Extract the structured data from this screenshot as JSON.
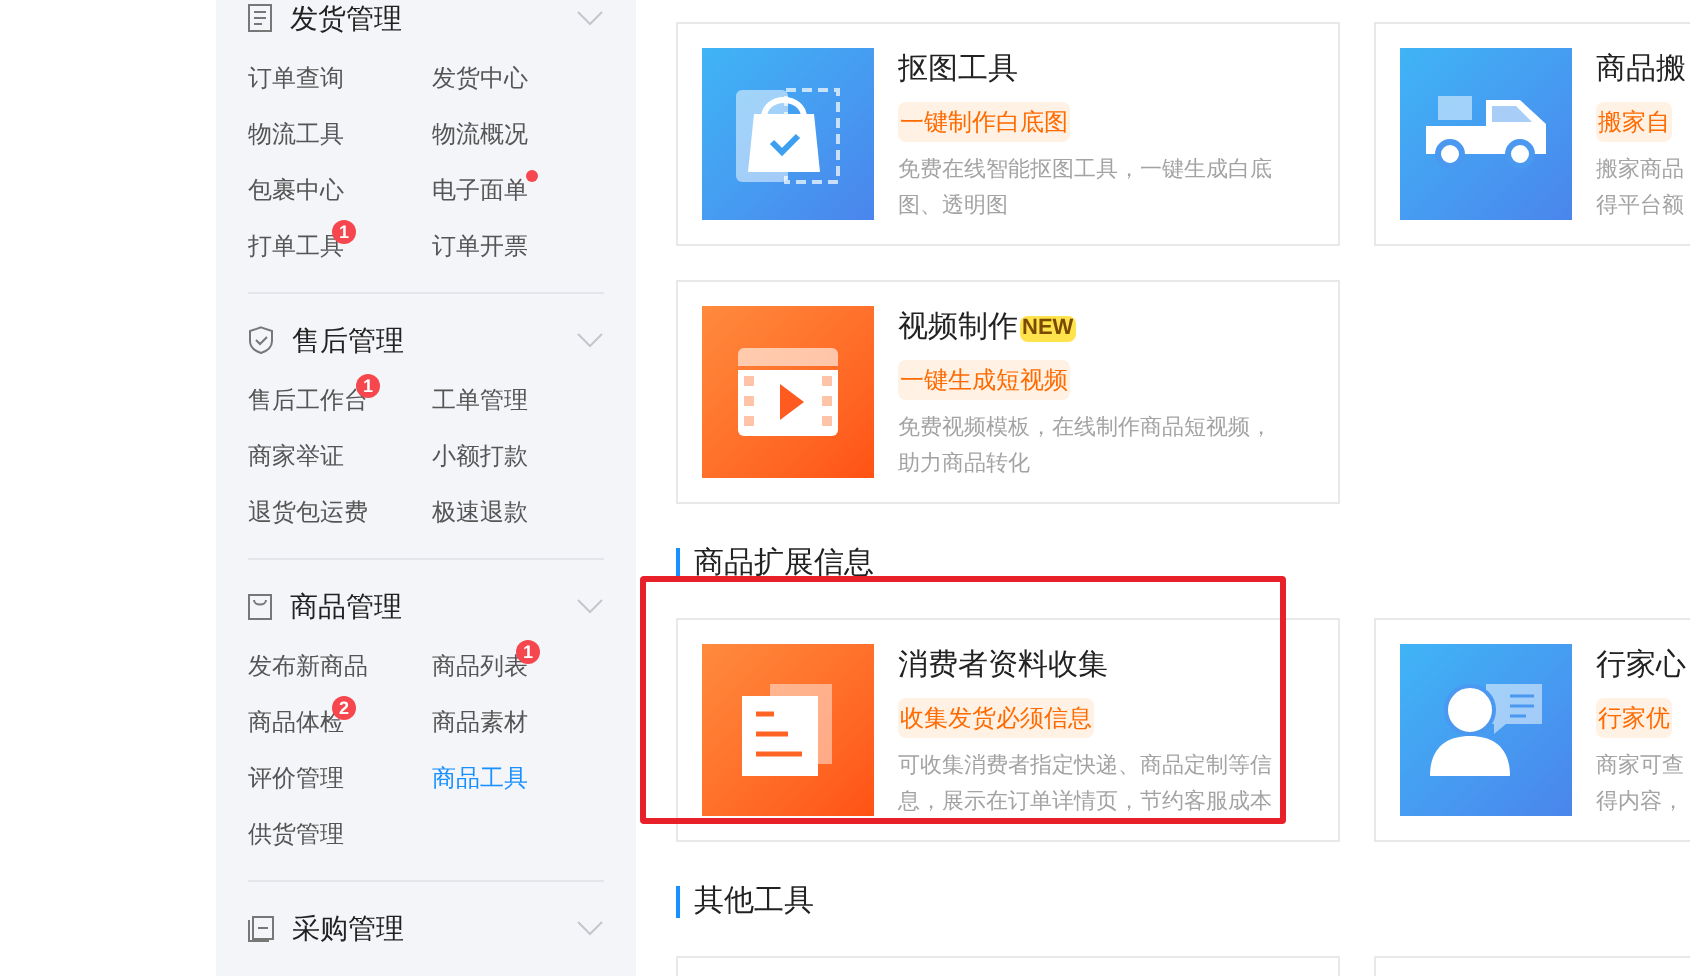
{
  "sidebar": {
    "groups": [
      {
        "title": "发货管理",
        "items": [
          {
            "label": "订单查询",
            "selected": false
          },
          {
            "label": "发货中心",
            "selected": false
          },
          {
            "label": "物流工具",
            "selected": false
          },
          {
            "label": "物流概况",
            "selected": false
          },
          {
            "label": "包裹中心",
            "selected": false
          },
          {
            "label": "电子面单",
            "selected": false,
            "dot": true
          },
          {
            "label": "打单工具",
            "selected": false,
            "badge": "1"
          },
          {
            "label": "订单开票",
            "selected": false
          }
        ]
      },
      {
        "title": "售后管理",
        "items": [
          {
            "label": "售后工作台",
            "selected": false,
            "badge": "1"
          },
          {
            "label": "工单管理",
            "selected": false
          },
          {
            "label": "商家举证",
            "selected": false
          },
          {
            "label": "小额打款",
            "selected": false
          },
          {
            "label": "退货包运费",
            "selected": false
          },
          {
            "label": "极速退款",
            "selected": false
          }
        ]
      },
      {
        "title": "商品管理",
        "items": [
          {
            "label": "发布新商品",
            "selected": false
          },
          {
            "label": "商品列表",
            "selected": false,
            "badge": "1"
          },
          {
            "label": "商品体检",
            "selected": false,
            "badge": "2"
          },
          {
            "label": "商品素材",
            "selected": false
          },
          {
            "label": "评价管理",
            "selected": false
          },
          {
            "label": "商品工具",
            "selected": true
          },
          {
            "label": "供货管理",
            "selected": false
          }
        ]
      },
      {
        "title": "采购管理"
      }
    ]
  },
  "sections": [
    {
      "cards": [
        {
          "title": "抠图工具",
          "tag": "一键制作白底图",
          "description": [
            "免费在线智能抠图工具，一键生成白底",
            "图、透明图"
          ]
        },
        {
          "title": "商品搬",
          "tag": "搬家自",
          "description": [
            "搬家商品",
            "得平台额"
          ]
        },
        {
          "title": "视频制作",
          "new_badge": "NEW",
          "tag": "一键生成短视频",
          "description": [
            "免费视频模板，在线制作商品短视频，",
            "助力商品转化"
          ]
        }
      ]
    },
    {
      "heading": "商品扩展信息",
      "cards": [
        {
          "title": "消费者资料收集",
          "highlighted": true,
          "tag": "收集发货必须信息",
          "description": [
            "可收集消费者指定快递、商品定制等信",
            "息，展示在订单详情页，节约客服成本"
          ]
        },
        {
          "title": "行家心",
          "tag": "行家优",
          "description": [
            "商家可查",
            "得内容，"
          ]
        }
      ]
    },
    {
      "heading": "其他工具",
      "cards": [
        {
          "stub": true
        },
        {
          "stub": true
        }
      ]
    }
  ]
}
